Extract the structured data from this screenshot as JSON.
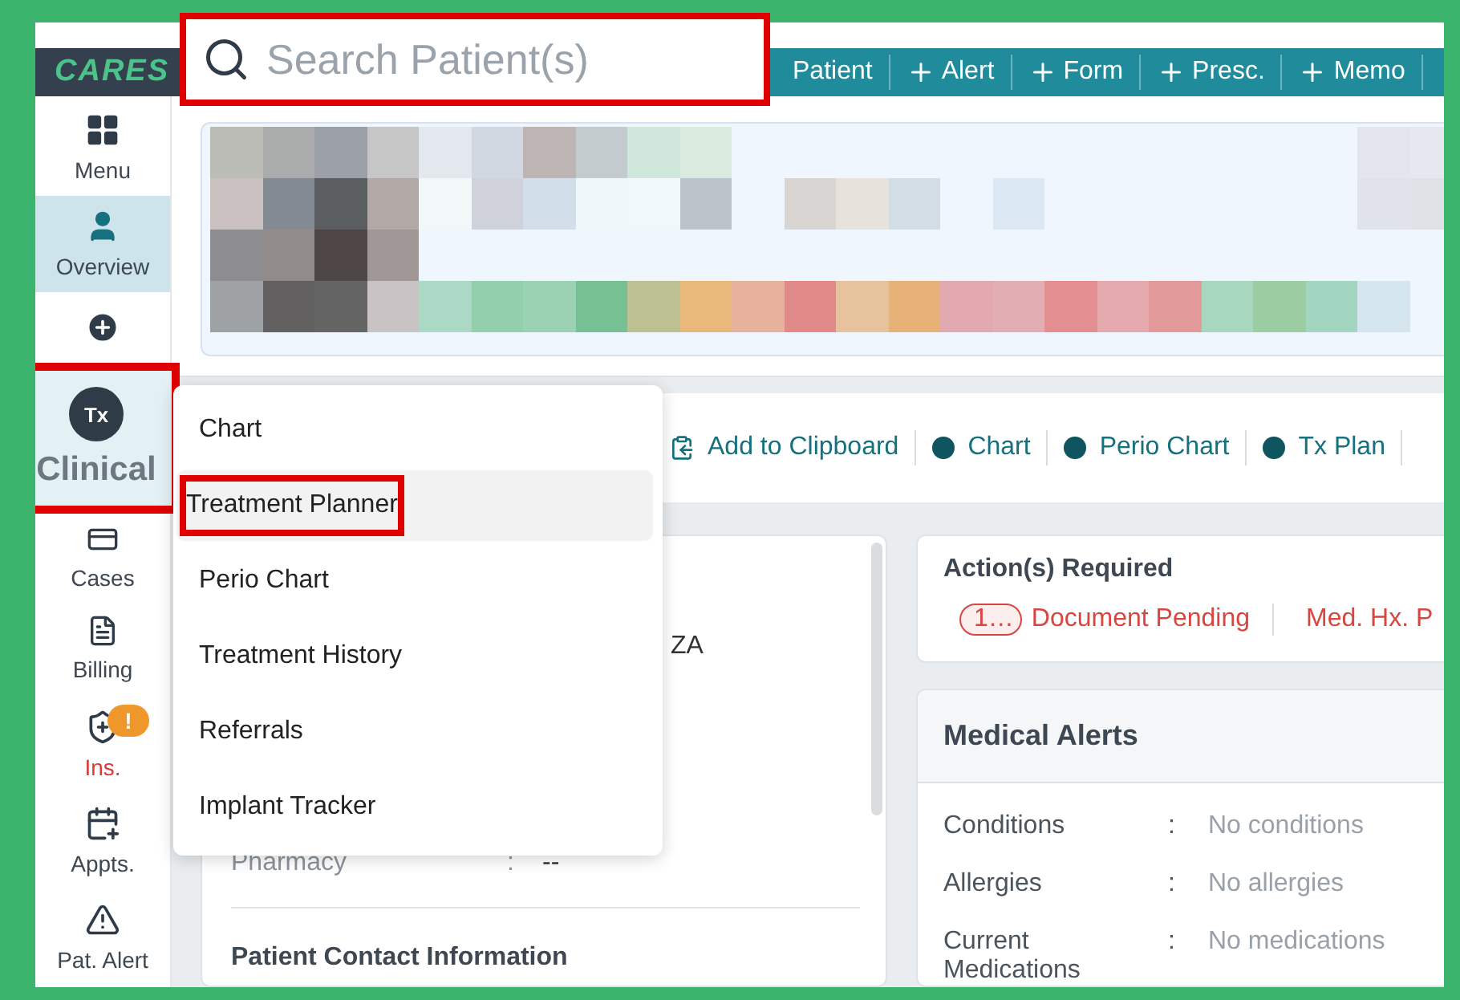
{
  "logo": "CARES",
  "search": {
    "placeholder": "Search Patient(s)",
    "highlighted": true
  },
  "header_actions": [
    {
      "label": "Patient",
      "kind": "text"
    },
    {
      "label": "Alert",
      "kind": "add"
    },
    {
      "label": "Form",
      "kind": "add"
    },
    {
      "label": "Presc.",
      "kind": "add"
    },
    {
      "label": "Memo",
      "kind": "add"
    }
  ],
  "sidebar": [
    {
      "kind": "grid",
      "label": "Menu",
      "selected": false,
      "highlighted": false,
      "warning": false
    },
    {
      "kind": "person",
      "label": "Overview",
      "selected": true,
      "highlighted": false,
      "warning": false
    },
    {
      "kind": "plus-circle",
      "selected": false,
      "highlighted": false
    },
    {
      "kind": "tx",
      "icon_label": "Tx",
      "label": "Clinical",
      "selected": false,
      "highlighted": true,
      "warning": false
    },
    {
      "kind": "cases",
      "label": "Cases",
      "selected": false,
      "highlighted": false,
      "warning": false
    },
    {
      "kind": "billing",
      "label": "Billing",
      "selected": false,
      "highlighted": false,
      "warning": false
    },
    {
      "kind": "shield",
      "label": "Ins.",
      "badge": "!",
      "selected": false,
      "highlighted": false,
      "warning": true
    },
    {
      "kind": "calendar",
      "label": "Appts.",
      "selected": false,
      "highlighted": false,
      "warning": false
    },
    {
      "kind": "alert",
      "label": "Pat. Alert",
      "selected": false,
      "highlighted": false,
      "warning": false
    }
  ],
  "toolbar": [
    {
      "kind": "clipboard",
      "label": "Add to Clipboard"
    },
    {
      "kind": "tx",
      "label": "Chart"
    },
    {
      "kind": "tx",
      "label": "Perio Chart"
    },
    {
      "kind": "tx",
      "label": "Tx Plan"
    }
  ],
  "menu": [
    {
      "label": "Chart",
      "selected": false,
      "highlighted": false
    },
    {
      "label": "Treatment Planner",
      "selected": true,
      "highlighted": true
    },
    {
      "label": "Perio Chart",
      "selected": false,
      "highlighted": false
    },
    {
      "label": "Treatment History",
      "selected": false,
      "highlighted": false
    },
    {
      "label": "Referrals",
      "selected": false,
      "highlighted": false
    },
    {
      "label": "Implant Tracker",
      "selected": false,
      "highlighted": false
    }
  ],
  "patient_panel": {
    "fragment": "ZA",
    "fields": [
      {
        "label": "Pharmacy",
        "separator": ":",
        "value": "--"
      }
    ],
    "section_title": "Patient Contact Information"
  },
  "actions": {
    "title": "Action(s) Required",
    "items": [
      {
        "count": "1…",
        "label": "Document Pending"
      },
      {
        "label": "Med. Hx. P"
      }
    ]
  },
  "medical_alerts": {
    "title": "Medical Alerts",
    "rows": [
      {
        "label": "Conditions",
        "separator": ":",
        "value": "No conditions"
      },
      {
        "label": "Allergies",
        "separator": ":",
        "value": "No allergies"
      },
      {
        "label": "Current Medications",
        "separator": ":",
        "value": "No medications"
      }
    ]
  }
}
